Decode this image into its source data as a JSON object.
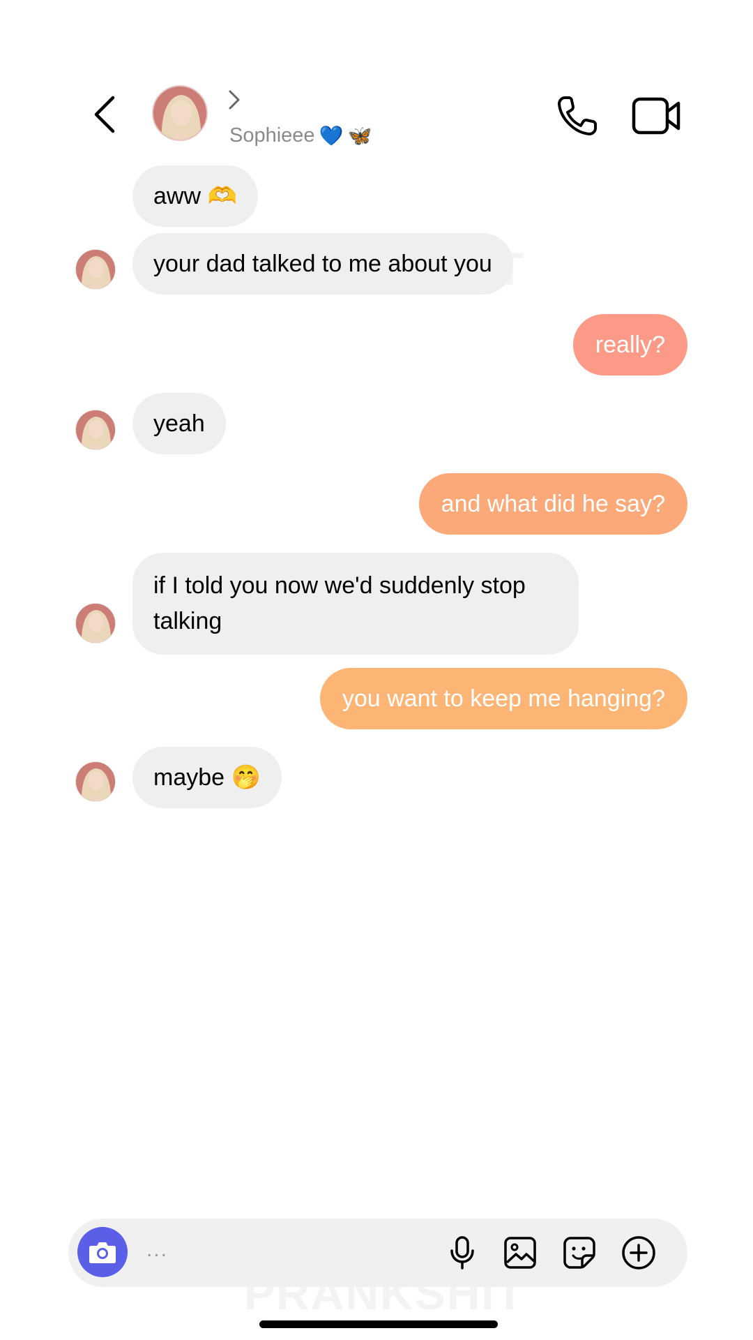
{
  "header": {
    "contact_name": "Sophieee",
    "name_emojis": [
      "💙",
      "🦋"
    ],
    "back_icon": "chevron-left-icon",
    "call_icon": "phone-icon",
    "video_icon": "video-camera-icon"
  },
  "watermark": "PRANKSHIT",
  "messages": [
    {
      "side": "received",
      "text": "aww 🫶"
    },
    {
      "side": "received",
      "text": "your dad talked to me about you"
    },
    {
      "side": "sent",
      "text": "really?"
    },
    {
      "side": "received",
      "text": "yeah"
    },
    {
      "side": "sent",
      "text": "and what did he say?"
    },
    {
      "side": "received",
      "text": "if I told you now we'd suddenly stop talking"
    },
    {
      "side": "sent",
      "text": "you want to keep me hanging?"
    },
    {
      "side": "received",
      "text": "maybe 🤭"
    }
  ],
  "colors": {
    "received_bubble": "#efefef",
    "sent_bubble_1": "#fb9a86",
    "sent_bubble_2": "#fca97a",
    "sent_bubble_3": "#fdb575",
    "camera_button": "#5b5fe8"
  },
  "composer": {
    "placeholder": "...",
    "icons": [
      "camera-icon",
      "microphone-icon",
      "gallery-icon",
      "sticker-icon",
      "plus-icon"
    ]
  }
}
